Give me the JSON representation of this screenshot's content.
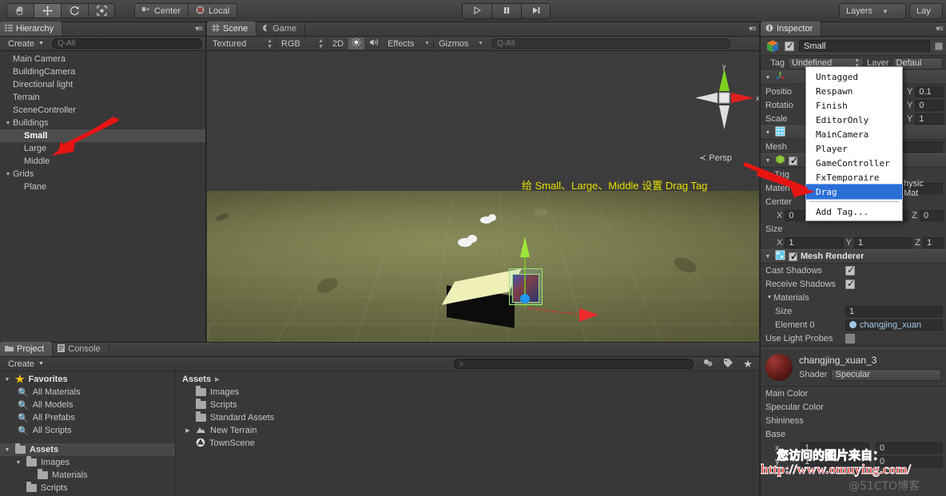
{
  "toolbar": {
    "tools": [
      {
        "name": "hand-tool",
        "icon": "hand-icon",
        "active": false
      },
      {
        "name": "move-tool",
        "icon": "move-icon",
        "active": true
      },
      {
        "name": "rotate-tool",
        "icon": "rotate-icon",
        "active": false
      },
      {
        "name": "scale-tool",
        "icon": "scale-icon",
        "active": false
      }
    ],
    "pivot_label": "Center",
    "space_label": "Local",
    "play_label": "play-icon",
    "pause_label": "pause-icon",
    "step_label": "step-icon",
    "layers_label": "Layers",
    "layout_label": "Lay"
  },
  "hierarchy": {
    "tab": "Hierarchy",
    "create_label": "Create",
    "search_placeholder": "Q-All",
    "items": [
      {
        "label": "Main Camera",
        "depth": 0,
        "arrow": "",
        "selected": false
      },
      {
        "label": "BuildingCamera",
        "depth": 0,
        "arrow": "",
        "selected": false
      },
      {
        "label": "Directional light",
        "depth": 0,
        "arrow": "",
        "selected": false
      },
      {
        "label": "Terrain",
        "depth": 0,
        "arrow": "",
        "selected": false
      },
      {
        "label": "SceneController",
        "depth": 0,
        "arrow": "",
        "selected": false
      },
      {
        "label": "Buildings",
        "depth": 0,
        "arrow": "▼",
        "selected": false
      },
      {
        "label": "Small",
        "depth": 1,
        "arrow": "",
        "selected": true
      },
      {
        "label": "Large",
        "depth": 1,
        "arrow": "",
        "selected": false
      },
      {
        "label": "Middle",
        "depth": 1,
        "arrow": "",
        "selected": false
      },
      {
        "label": "Grids",
        "depth": 0,
        "arrow": "▼",
        "selected": false
      },
      {
        "label": "Plane",
        "depth": 1,
        "arrow": "",
        "selected": false
      }
    ]
  },
  "scene": {
    "tab_scene": "Scene",
    "tab_game": "Game",
    "draw_mode": "Textured",
    "color_mode": "RGB",
    "btn_2d": "2D",
    "btn_light": "light-icon",
    "btn_audio": "audio-icon",
    "effects_label": "Effects",
    "gizmos_label": "Gizmos",
    "search_placeholder": "Q-All",
    "annotation": "给 Small、Large、Middle 设置 Drag Tag",
    "persp_label": "Persp",
    "axis_y": "y",
    "axis_x": "x"
  },
  "project": {
    "tab_project": "Project",
    "tab_console": "Console",
    "create_label": "Create",
    "search_placeholder": "",
    "favorites_label": "Favorites",
    "favorites": [
      "All Materials",
      "All Models",
      "All Prefabs",
      "All Scripts"
    ],
    "assets_label": "Assets",
    "tree": [
      {
        "label": "Images",
        "depth": 1,
        "arrow": "▼",
        "icon": "folder-icon"
      },
      {
        "label": "Materials",
        "depth": 2,
        "arrow": "",
        "icon": "folder-icon"
      },
      {
        "label": "Scripts",
        "depth": 1,
        "arrow": "",
        "icon": "folder-icon"
      }
    ],
    "breadcrumb": "Assets",
    "contents": [
      {
        "label": "Images",
        "icon": "folder-icon",
        "arrow": ""
      },
      {
        "label": "Scripts",
        "icon": "folder-icon",
        "arrow": ""
      },
      {
        "label": "Standard Assets",
        "icon": "folder-icon",
        "arrow": ""
      },
      {
        "label": "New Terrain",
        "icon": "terrain-icon",
        "arrow": "▶"
      },
      {
        "label": "TownScene",
        "icon": "unity-scene-icon",
        "arrow": ""
      }
    ]
  },
  "inspector": {
    "tab": "Inspector",
    "object_name": "Small",
    "tag_label": "Tag",
    "tag_value": "Undefined",
    "layer_label": "Layer",
    "layer_value": "Defaul",
    "transform": {
      "position_label": "Positio",
      "rotation_label": "Rotatio",
      "scale_label": "Scale",
      "position_y": "0.1",
      "rotation_y": "0",
      "scale_y": "1"
    },
    "mesh_filter": {
      "mesh_label": "Mesh"
    },
    "box_collider": {
      "is_trigger_label": "Is Trig",
      "material_label": "Materi",
      "material_value": "hysic Mat",
      "center_label": "Center",
      "center_x": "0",
      "center_z": "0",
      "size_label": "Size",
      "size_x": "1",
      "size_y": "1",
      "size_z": "1"
    },
    "mesh_renderer": {
      "title": "Mesh Renderer",
      "cast_shadows_label": "Cast Shadows",
      "cast_shadows_checked": true,
      "receive_shadows_label": "Receive Shadows",
      "receive_shadows_checked": true,
      "materials_label": "Materials",
      "size_label": "Size",
      "size_value": "1",
      "element0_label": "Element 0",
      "element0_value": "changjing_xuan",
      "use_light_probes_label": "Use Light Probes",
      "use_light_probes_checked": false
    },
    "material": {
      "name": "changjing_xuan_3",
      "shader_label": "Shader",
      "shader_value": "Specular",
      "props": [
        "Main Color",
        "Specular Color",
        "Shininess",
        "Base"
      ],
      "tile_x_label": "x",
      "tile_x_value": "1",
      "tile_y_label": "y",
      "tile_y_value": "1",
      "offset_x_value": "0",
      "offset_y_value": "0"
    }
  },
  "tag_menu": {
    "items": [
      {
        "label": "Untagged",
        "selected": false
      },
      {
        "label": "Respawn",
        "selected": false
      },
      {
        "label": "Finish",
        "selected": false
      },
      {
        "label": "EditorOnly",
        "selected": false
      },
      {
        "label": "MainCamera",
        "selected": false
      },
      {
        "label": "Player",
        "selected": false
      },
      {
        "label": "GameController",
        "selected": false
      },
      {
        "label": "FxTemporaire",
        "selected": false
      },
      {
        "label": "Drag",
        "selected": true
      }
    ],
    "add_tag_label": "Add Tag..."
  },
  "watermark": {
    "chinese": "您访问的图片来自：",
    "url": "http://www.omuying.com/",
    "site": "@51CTO博客"
  },
  "colors": {
    "accent_selected": "#2a6ed8",
    "annotation_yellow": "#e8e000",
    "arrow_red": "#e02020",
    "axis_x": "#e03030",
    "axis_y": "#7ed321"
  }
}
